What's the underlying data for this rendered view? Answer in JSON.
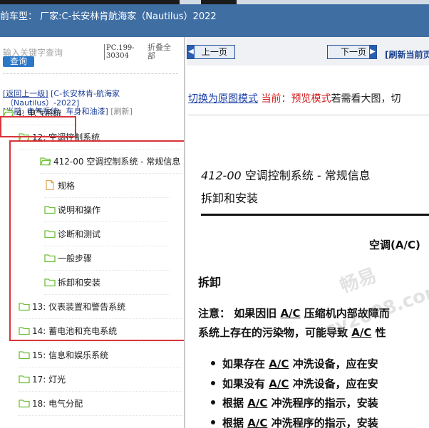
{
  "header": {
    "title": "前车型：  厂家:C-长安林肯航海家（Nautilus）2022"
  },
  "sidebar": {
    "search_placeholder": "输入关键字查询",
    "search_button": "查询",
    "pc_code_line1": "PC.199-",
    "pc_code_line2": "30304",
    "collapse_line1": "折叠全",
    "collapse_line2": "部",
    "back_link": "[返回上一级]",
    "back_path_line1": "[C-长安林肯-航海家",
    "back_path_line2": "（Nautilus）-2022]",
    "current_label": "[当前: 电气系统、车身和油漆]",
    "refresh_label": "[刷新]",
    "tree": [
      {
        "label": "4: 电气系统",
        "icon": "folder-open-icon"
      },
      {
        "label": "12: 空调控制系统",
        "icon": "folder-open-icon"
      },
      {
        "label": "412-00 空调控制系统 - 常规信息",
        "icon": "folder-open-icon"
      },
      {
        "label": "规格",
        "icon": "document-icon"
      },
      {
        "label": "说明和操作",
        "icon": "folder-icon"
      },
      {
        "label": "诊断和测试",
        "icon": "folder-icon"
      },
      {
        "label": "一般步骤",
        "icon": "folder-icon"
      },
      {
        "label": "拆卸和安装",
        "icon": "folder-icon"
      },
      {
        "label": "13: 仪表装置和警告系统",
        "icon": "folder-icon"
      },
      {
        "label": "14: 蓄电池和充电系统",
        "icon": "folder-icon"
      },
      {
        "label": "15: 信息和娱乐系统",
        "icon": "folder-icon"
      },
      {
        "label": "17: 灯光",
        "icon": "folder-icon"
      },
      {
        "label": "18: 电气分配",
        "icon": "folder-icon"
      }
    ]
  },
  "content": {
    "prev_page": "上一页",
    "next_page": "下一页",
    "refresh_page": "[刷新当前页",
    "switch_link": "切换为原图模式",
    "current_mode": "当前：预览模式",
    "hint": "若需看大图，切",
    "doc_title_code": "412-00",
    "doc_title_text": " 空调控制系统 - 常规信息",
    "doc_subtitle": "拆卸和安装",
    "section_heading": "空调(A/C)",
    "removal_heading": "拆卸",
    "note_line1_a": "注意：  如果因旧 ",
    "note_line1_ac": "A/C",
    "note_line1_b": " 压缩机内部故障而",
    "note_line2_a": "系统上存在的污染物，可能导致 ",
    "note_line2_ac": "A/C",
    "note_line2_b": " 性",
    "bullets": [
      {
        "a": "如果存在 ",
        "ac": "A/C",
        "b": " 冲洗设备，应在安"
      },
      {
        "a": "如果没有 ",
        "ac": "A/C",
        "b": " 冲洗设备，应在安"
      },
      {
        "a": "根据 ",
        "ac": "A/C",
        "b": " 冲洗程序的指示，安装"
      },
      {
        "a": "根据 ",
        "ac": "A/C",
        "b": " 冲洗程序的指示，安装"
      }
    ]
  },
  "watermark": {
    "line1": "畅易",
    "line2": "cy2008.com"
  },
  "colors": {
    "header_bg": "#3f6ea3",
    "accent_blue": "#2b78c8",
    "highlight_red": "#d9343a",
    "folder_green": "#6fbf3a"
  }
}
